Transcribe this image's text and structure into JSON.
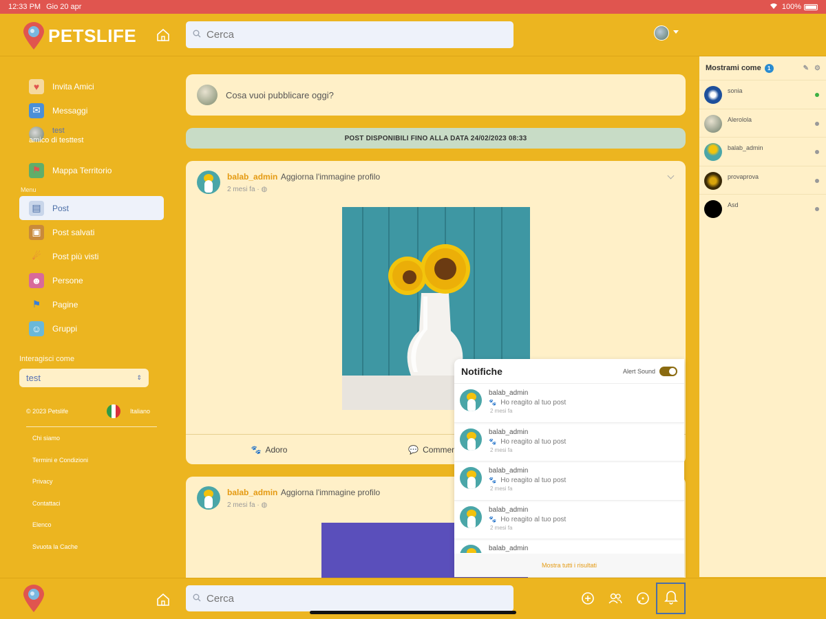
{
  "status": {
    "time": "12:33 PM",
    "date": "Gio 20 apr",
    "battery": "100%"
  },
  "app": {
    "name": "PETSLIFE",
    "brand_color": "#ECB520",
    "pin_color": "#E0554F"
  },
  "search": {
    "placeholder": "Cerca"
  },
  "sidebar": {
    "items": [
      {
        "label": "Invita Amici",
        "icon": "invite-icon"
      },
      {
        "label": "Messaggi",
        "icon": "messages-icon"
      }
    ],
    "test_user": {
      "name": "test",
      "subtitle": "amico di testtest"
    },
    "map": {
      "label": "Mappa Territorio",
      "icon": "map-icon"
    },
    "section_label": "Menu",
    "menu": [
      {
        "label": "Post",
        "icon": "post-icon",
        "active": true
      },
      {
        "label": "Post salvati",
        "icon": "saved-icon"
      },
      {
        "label": "Post più visti",
        "icon": "trending-icon"
      },
      {
        "label": "Persone",
        "icon": "people-icon"
      },
      {
        "label": "Pagine",
        "icon": "pages-icon"
      },
      {
        "label": "Gruppi",
        "icon": "groups-icon"
      }
    ],
    "interact_label": "Interagisci come",
    "interact_value": "test",
    "copyright": "© 2023 Petslife",
    "language": "Italiano",
    "links": [
      "Chi siamo",
      "Termini e Condizioni",
      "Privacy",
      "Contattaci",
      "Elenco",
      "Svuota la Cache"
    ]
  },
  "composer": {
    "placeholder": "Cosa vuoi pubblicare oggi?"
  },
  "banner": "POST DISPONIBILI FINO ALLA DATA 24/02/2023 08:33",
  "posts": [
    {
      "author": "balab_admin",
      "action": "Aggiorna l'immagine profilo",
      "time": "2 mesi fa ·",
      "like_label": "Adoro",
      "comment_label": "Commenta"
    },
    {
      "author": "balab_admin",
      "action": "Aggiorna l'immagine profilo",
      "time": "2 mesi fa ·"
    }
  ],
  "right_panel": {
    "title": "Mostrami come",
    "badge": "1",
    "contacts": [
      {
        "name": "sonia",
        "status": "online",
        "status_color": "#3cb043"
      },
      {
        "name": "Alerolola",
        "status": "offline",
        "status_color": "#999999"
      },
      {
        "name": "balab_admin",
        "status": "offline",
        "status_color": "#999999"
      },
      {
        "name": "provaprova",
        "status": "offline",
        "status_color": "#999999"
      },
      {
        "name": "Asd",
        "status": "offline",
        "status_color": "#999999"
      }
    ]
  },
  "notifications": {
    "title": "Notifiche",
    "alert_label": "Alert Sound",
    "alert_on": true,
    "items": [
      {
        "user": "balab_admin",
        "text": "Ho reagito al tuo post",
        "time": "2 mesi fa"
      },
      {
        "user": "balab_admin",
        "text": "Ho reagito al tuo post",
        "time": "2 mesi fa"
      },
      {
        "user": "balab_admin",
        "text": "Ho reagito al tuo post",
        "time": "2 mesi fa"
      },
      {
        "user": "balab_admin",
        "text": "Ho reagito al tuo post",
        "time": "2 mesi fa"
      },
      {
        "user": "balab_admin",
        "text": "",
        "time": ""
      }
    ],
    "footer": "Mostra tutti i risultati"
  }
}
